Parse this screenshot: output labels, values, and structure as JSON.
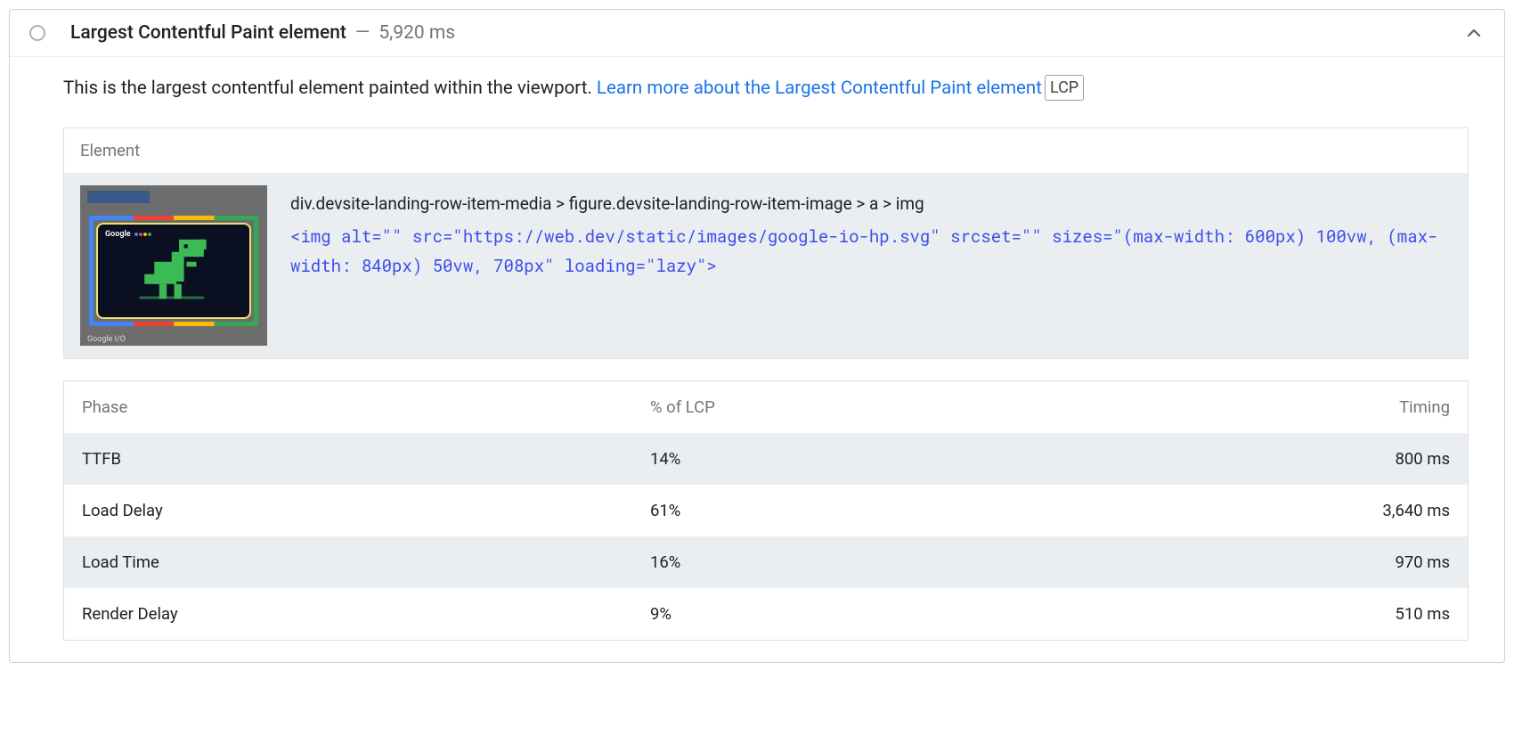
{
  "audit": {
    "title": "Largest Contentful Paint element",
    "separator": "—",
    "timing": "5,920 ms",
    "description_prefix": "This is the largest contentful element painted within the viewport. ",
    "learn_more": "Learn more about the Largest Contentful Paint element",
    "badge": "LCP"
  },
  "element_card": {
    "header": "Element",
    "selector": "div.devsite-landing-row-item-media > figure.devsite-landing-row-item-image > a > img",
    "snippet": "<img alt=\"\" src=\"https://web.dev/static/images/google-io-hp.svg\" srcset=\"\" sizes=\"(max-width: 600px) 100vw, (max-width: 840px) 50vw, 708px\" loading=\"lazy\">",
    "thumb_brand": "Google",
    "thumb_caption": "Google I/O"
  },
  "phase_table": {
    "columns": {
      "phase": "Phase",
      "pct": "% of LCP",
      "timing": "Timing"
    },
    "rows": [
      {
        "phase": "TTFB",
        "pct": "14%",
        "timing": "800 ms"
      },
      {
        "phase": "Load Delay",
        "pct": "61%",
        "timing": "3,640 ms"
      },
      {
        "phase": "Load Time",
        "pct": "16%",
        "timing": "970 ms"
      },
      {
        "phase": "Render Delay",
        "pct": "9%",
        "timing": "510 ms"
      }
    ]
  }
}
